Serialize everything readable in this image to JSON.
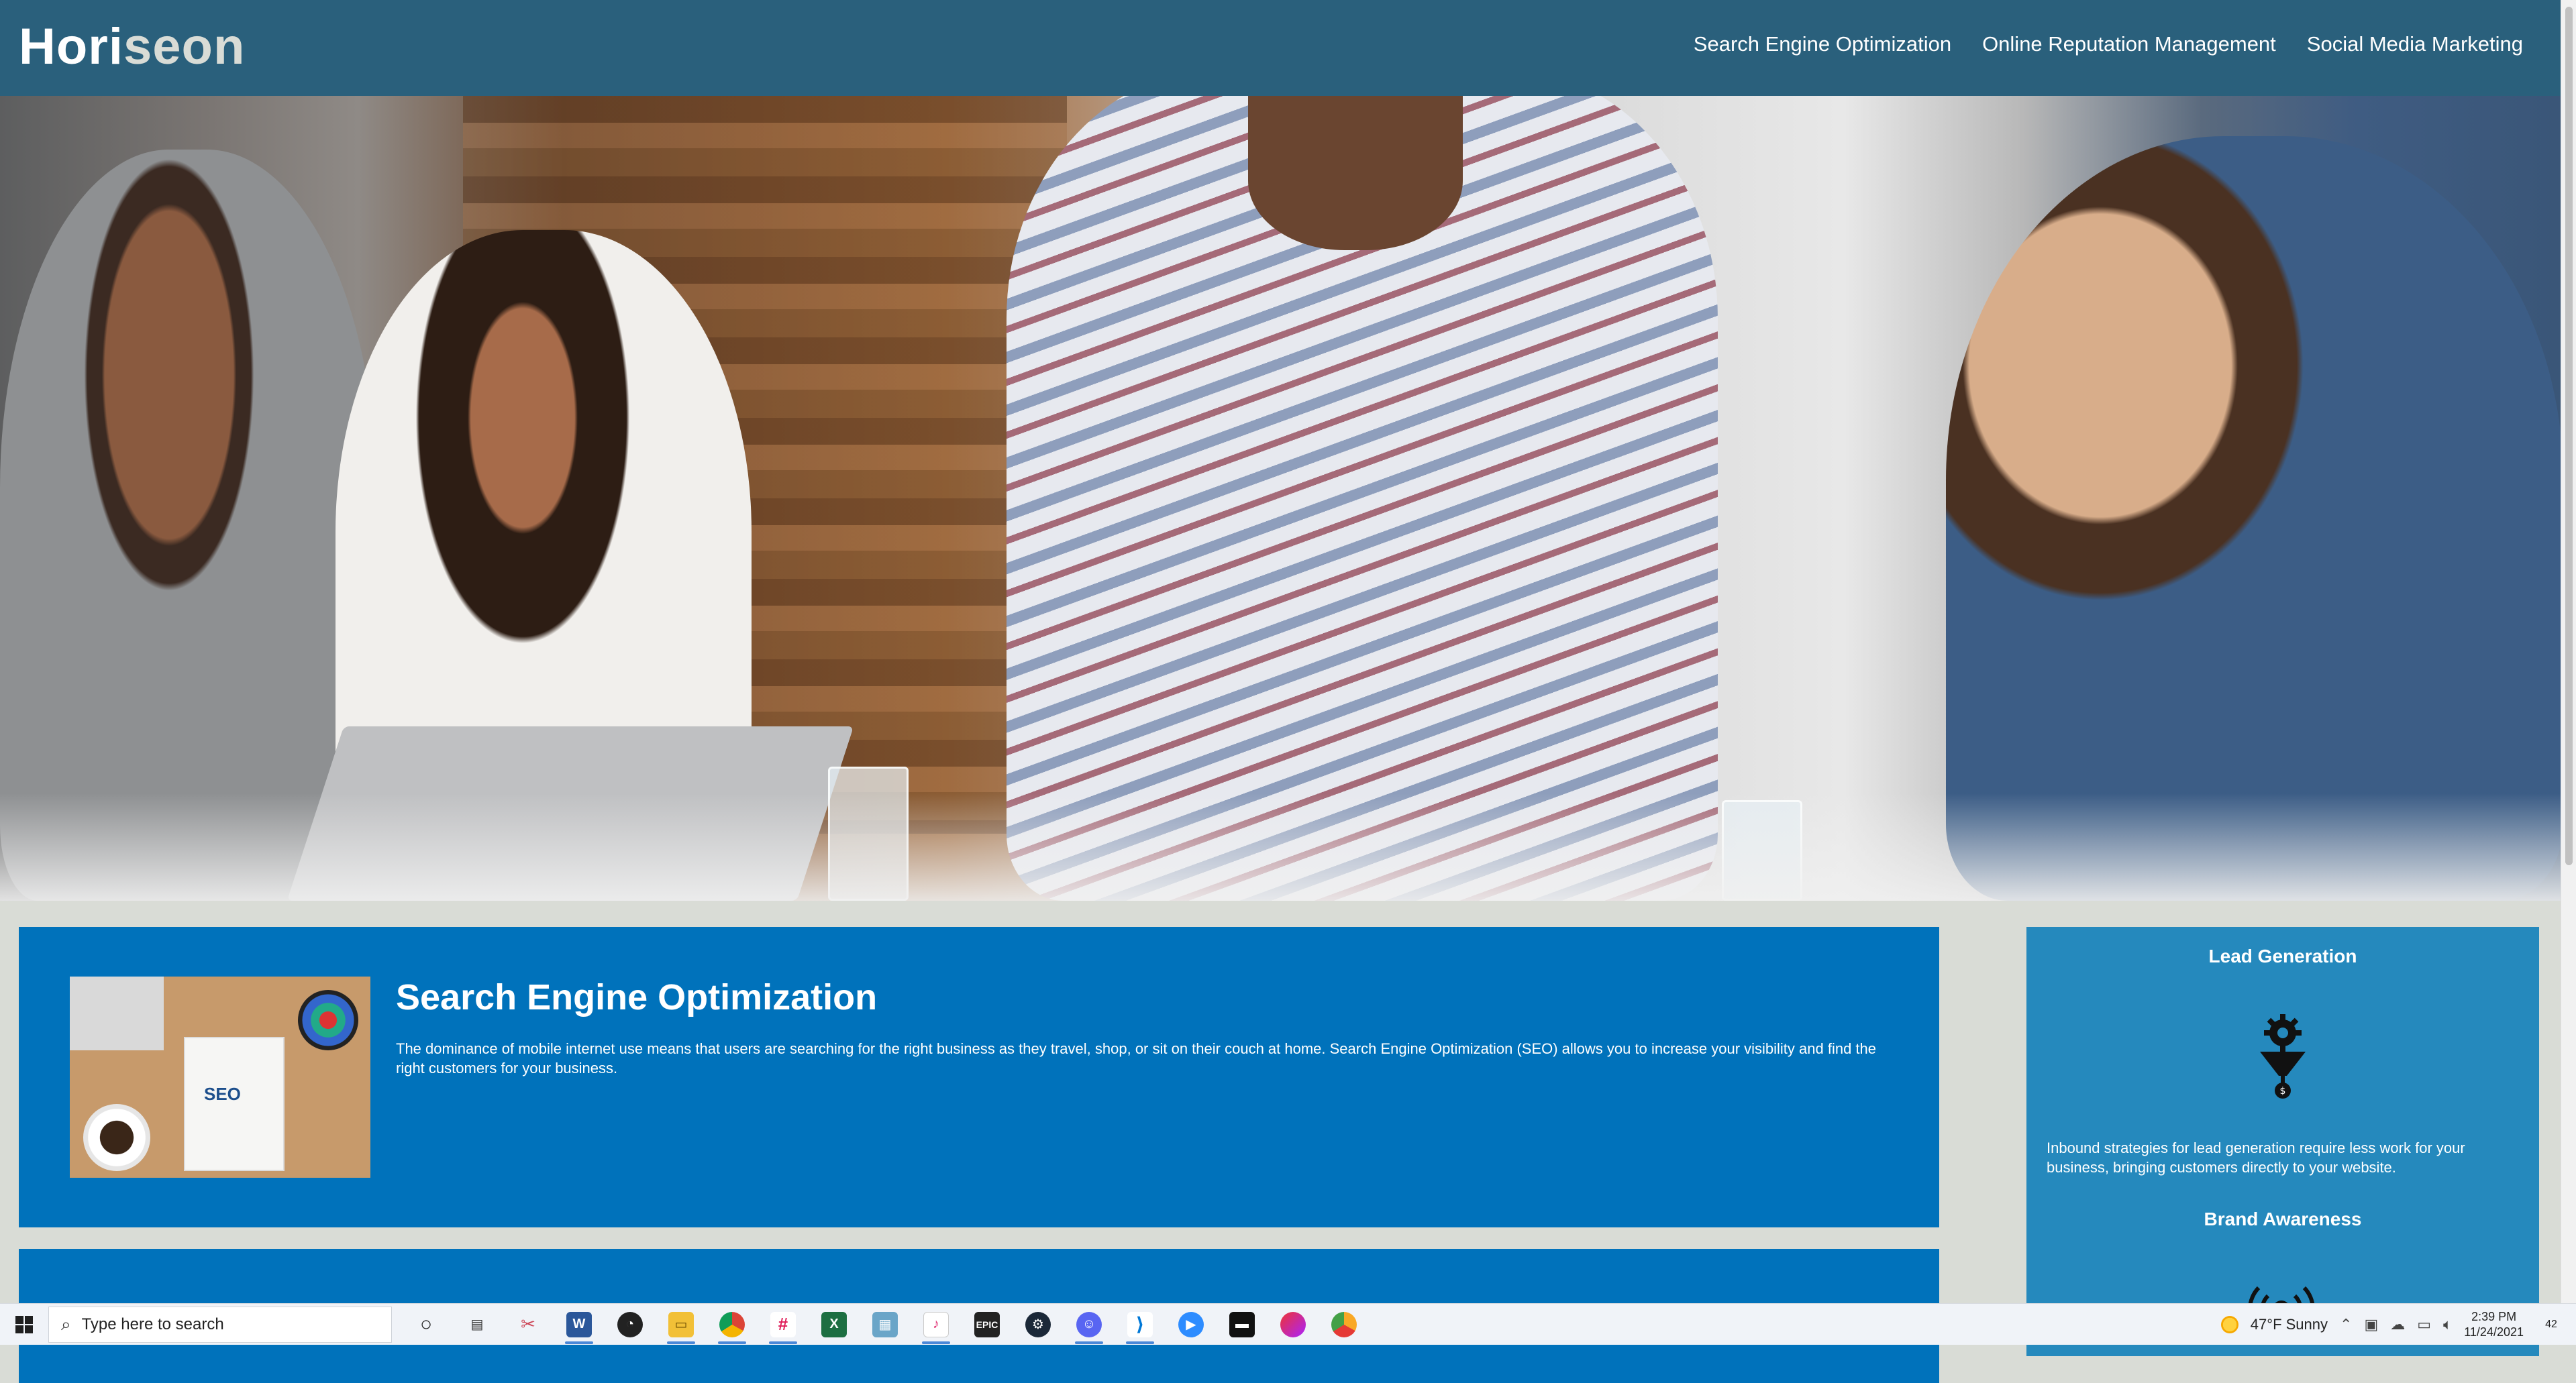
{
  "header": {
    "logo_main": "Hori",
    "logo_accent": "seon",
    "nav": [
      {
        "label": "Search Engine Optimization"
      },
      {
        "label": "Online Reputation Management"
      },
      {
        "label": "Social Media Marketing"
      }
    ]
  },
  "colors": {
    "header_bg": "#2a607c",
    "page_bg": "#d9dcd6",
    "card_bg": "#0072bb",
    "sidebar_bg": "#2589bd"
  },
  "main": {
    "seo": {
      "title": "Search Engine Optimization",
      "text": "The dominance of mobile internet use means that users are searching for the right business as they travel, shop, or sit on their couch at home. Search Engine Optimization (SEO) allows you to increase your visibility and find the right customers for your business.",
      "image_label": "SEO"
    }
  },
  "sidebar": {
    "lead": {
      "title": "Lead Generation",
      "text": "Inbound strategies for lead generation require less work for your business, bringing customers directly to your website.",
      "icon": "lead-funnel-icon"
    },
    "brand": {
      "title": "Brand Awareness",
      "icon": "broadcast-icon"
    }
  },
  "taskbar": {
    "search_placeholder": "Type here to search",
    "weather": "47°F  Sunny",
    "time": "2:39 PM",
    "date": "11/24/2021",
    "notification_count": "42",
    "apps": [
      {
        "name": "task-view-icon"
      },
      {
        "name": "widgets-icon"
      },
      {
        "name": "snipping-tool-icon"
      },
      {
        "name": "word-icon"
      },
      {
        "name": "speedometer-icon"
      },
      {
        "name": "file-explorer-icon"
      },
      {
        "name": "chrome-icon"
      },
      {
        "name": "slack-icon"
      },
      {
        "name": "excel-icon"
      },
      {
        "name": "terminal-icon"
      },
      {
        "name": "itunes-icon"
      },
      {
        "name": "epic-games-icon"
      },
      {
        "name": "steam-icon"
      },
      {
        "name": "discord-icon"
      },
      {
        "name": "vscode-icon"
      },
      {
        "name": "zoom-icon"
      },
      {
        "name": "command-prompt-icon"
      },
      {
        "name": "app-icon"
      },
      {
        "name": "chrome-canary-icon"
      }
    ]
  }
}
